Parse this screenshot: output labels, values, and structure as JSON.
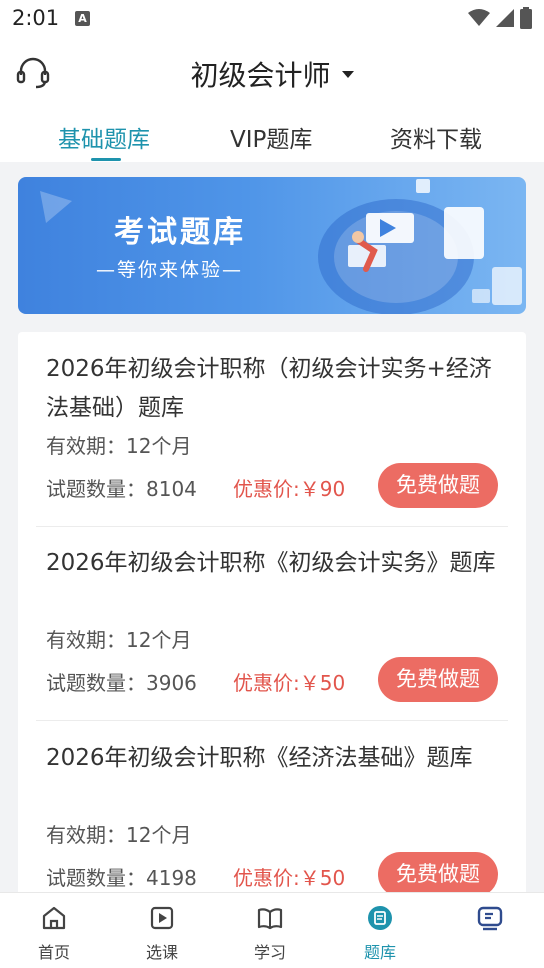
{
  "status_bar": {
    "time": "2:01",
    "notif_letter": "A"
  },
  "header": {
    "title": "初级会计师",
    "tabs": [
      {
        "label": "基础题库",
        "active": true
      },
      {
        "label": "VIP题库",
        "active": false
      },
      {
        "label": "资料下载",
        "active": false
      }
    ]
  },
  "banner": {
    "title": "考试题库",
    "subtitle": "—等你来体验—"
  },
  "items": [
    {
      "title": "2026年初级会计职称（初级会计实务+经济法基础）题库",
      "validity": "有效期：12个月",
      "count": "试题数量：8104",
      "price": "优惠价:￥90",
      "button": "免费做题"
    },
    {
      "title": "2026年初级会计职称《初级会计实务》题库",
      "validity": "有效期：12个月",
      "count": "试题数量：3906",
      "price": "优惠价:￥50",
      "button": "免费做题"
    },
    {
      "title": "2026年初级会计职称《经济法基础》题库",
      "validity": "有效期：12个月",
      "count": "试题数量：4198",
      "price": "优惠价:￥50",
      "button": "免费做题"
    }
  ],
  "bottom_nav": [
    {
      "label": "首页",
      "icon": "home-icon",
      "active": false
    },
    {
      "label": "选课",
      "icon": "course-icon",
      "active": false
    },
    {
      "label": "学习",
      "icon": "book-icon",
      "active": false
    },
    {
      "label": "题库",
      "icon": "question-bank-icon",
      "active": true
    },
    {
      "label": "",
      "icon": "exam-icon",
      "active": false
    }
  ],
  "colors": {
    "accent": "#1e93ad",
    "price": "#e2554c",
    "button": "#ec6c63"
  }
}
